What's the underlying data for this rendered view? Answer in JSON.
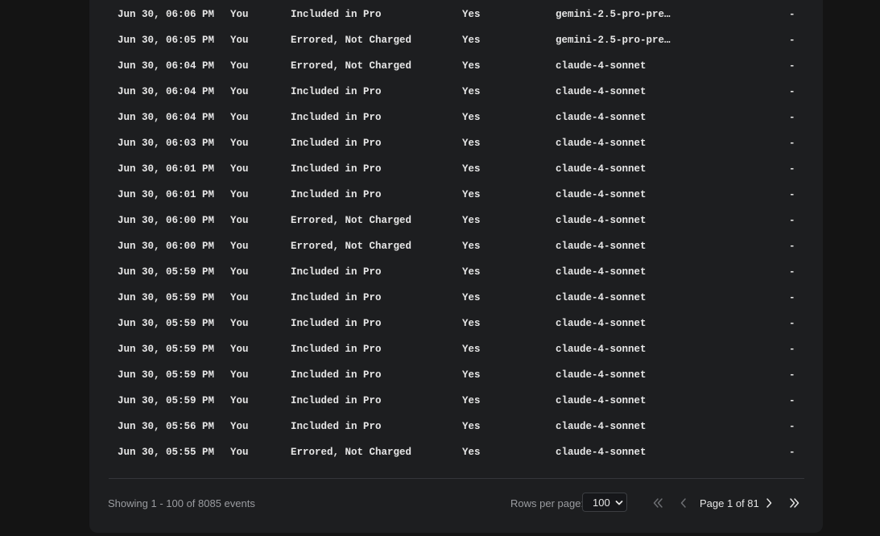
{
  "table": {
    "rows": [
      {
        "date": "Jun 30, 06:06 PM",
        "user": "You",
        "kind": "Included in Pro",
        "max_mode": "Yes",
        "model": "gemini-2.5-pro-prev…",
        "cost": "-"
      },
      {
        "date": "Jun 30, 06:05 PM",
        "user": "You",
        "kind": "Errored, Not Charged",
        "max_mode": "Yes",
        "model": "gemini-2.5-pro-prev…",
        "cost": "-"
      },
      {
        "date": "Jun 30, 06:04 PM",
        "user": "You",
        "kind": "Errored, Not Charged",
        "max_mode": "Yes",
        "model": "claude-4-sonnet",
        "cost": "-"
      },
      {
        "date": "Jun 30, 06:04 PM",
        "user": "You",
        "kind": "Included in Pro",
        "max_mode": "Yes",
        "model": "claude-4-sonnet",
        "cost": "-"
      },
      {
        "date": "Jun 30, 06:04 PM",
        "user": "You",
        "kind": "Included in Pro",
        "max_mode": "Yes",
        "model": "claude-4-sonnet",
        "cost": "-"
      },
      {
        "date": "Jun 30, 06:03 PM",
        "user": "You",
        "kind": "Included in Pro",
        "max_mode": "Yes",
        "model": "claude-4-sonnet",
        "cost": "-"
      },
      {
        "date": "Jun 30, 06:01 PM",
        "user": "You",
        "kind": "Included in Pro",
        "max_mode": "Yes",
        "model": "claude-4-sonnet",
        "cost": "-"
      },
      {
        "date": "Jun 30, 06:01 PM",
        "user": "You",
        "kind": "Included in Pro",
        "max_mode": "Yes",
        "model": "claude-4-sonnet",
        "cost": "-"
      },
      {
        "date": "Jun 30, 06:00 PM",
        "user": "You",
        "kind": "Errored, Not Charged",
        "max_mode": "Yes",
        "model": "claude-4-sonnet",
        "cost": "-"
      },
      {
        "date": "Jun 30, 06:00 PM",
        "user": "You",
        "kind": "Errored, Not Charged",
        "max_mode": "Yes",
        "model": "claude-4-sonnet",
        "cost": "-"
      },
      {
        "date": "Jun 30, 05:59 PM",
        "user": "You",
        "kind": "Included in Pro",
        "max_mode": "Yes",
        "model": "claude-4-sonnet",
        "cost": "-"
      },
      {
        "date": "Jun 30, 05:59 PM",
        "user": "You",
        "kind": "Included in Pro",
        "max_mode": "Yes",
        "model": "claude-4-sonnet",
        "cost": "-"
      },
      {
        "date": "Jun 30, 05:59 PM",
        "user": "You",
        "kind": "Included in Pro",
        "max_mode": "Yes",
        "model": "claude-4-sonnet",
        "cost": "-"
      },
      {
        "date": "Jun 30, 05:59 PM",
        "user": "You",
        "kind": "Included in Pro",
        "max_mode": "Yes",
        "model": "claude-4-sonnet",
        "cost": "-"
      },
      {
        "date": "Jun 30, 05:59 PM",
        "user": "You",
        "kind": "Included in Pro",
        "max_mode": "Yes",
        "model": "claude-4-sonnet",
        "cost": "-"
      },
      {
        "date": "Jun 30, 05:59 PM",
        "user": "You",
        "kind": "Included in Pro",
        "max_mode": "Yes",
        "model": "claude-4-sonnet",
        "cost": "-"
      },
      {
        "date": "Jun 30, 05:56 PM",
        "user": "You",
        "kind": "Included in Pro",
        "max_mode": "Yes",
        "model": "claude-4-sonnet",
        "cost": "-"
      },
      {
        "date": "Jun 30, 05:55 PM",
        "user": "You",
        "kind": "Errored, Not Charged",
        "max_mode": "Yes",
        "model": "claude-4-sonnet",
        "cost": "-"
      }
    ]
  },
  "footer": {
    "showing": "Showing 1 - 100 of 8085 events",
    "rows_per_page_label": "Rows per page:",
    "rows_per_page_value": "100",
    "page_label": "Page 1 of 81",
    "icons": {
      "first": "chevrons-left-icon",
      "prev": "chevron-left-icon",
      "next": "chevron-right-icon",
      "last": "chevrons-right-icon",
      "select_caret": "chevron-down-icon"
    }
  },
  "colors": {
    "page_background": "#141414",
    "panel_background": "#1d1e20",
    "text_primary": "#e6e6e6",
    "text_muted": "#9a9ca0",
    "icon_disabled": "#6d6f73"
  }
}
